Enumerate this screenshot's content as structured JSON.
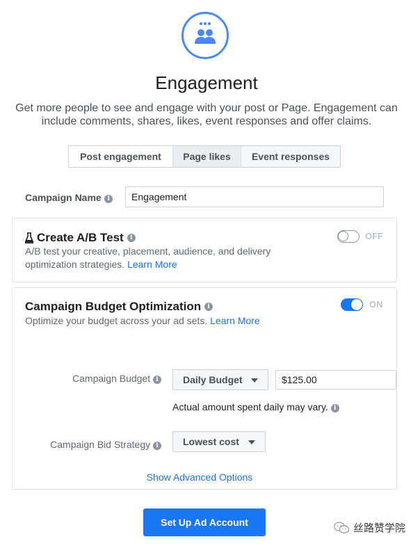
{
  "objective": {
    "title": "Engagement",
    "description": "Get more people to see and engage with your post or Page. Engagement can include comments, shares, likes, event responses and offer claims."
  },
  "tabs": [
    {
      "label": "Post engagement"
    },
    {
      "label": "Page likes"
    },
    {
      "label": "Event responses"
    }
  ],
  "campaign_name": {
    "label": "Campaign Name",
    "value": "Engagement"
  },
  "ab_test": {
    "icon": "flask-icon",
    "title": "Create A/B Test",
    "description": "A/B test your creative, placement, audience, and delivery optimization strategies.",
    "link": "Learn More",
    "toggle_state": "OFF"
  },
  "cbo": {
    "title": "Campaign Budget Optimization",
    "description": "Optimize your budget across your ad sets.",
    "link": "Learn More",
    "toggle_state": "ON",
    "budget_label": "Campaign Budget",
    "budget_type": "Daily Budget",
    "budget_value": "$125.00",
    "budget_note": "Actual amount spent daily may vary.",
    "bid_label": "Campaign Bid Strategy",
    "bid_value": "Lowest cost",
    "advanced_link": "Show Advanced Options"
  },
  "cta": {
    "label": "Set Up Ad Account"
  },
  "watermark": {
    "text": "丝路赞学院"
  },
  "colors": {
    "primary": "#1877f2",
    "link": "#1a73e8",
    "icon_ring": "#4a89f5"
  }
}
